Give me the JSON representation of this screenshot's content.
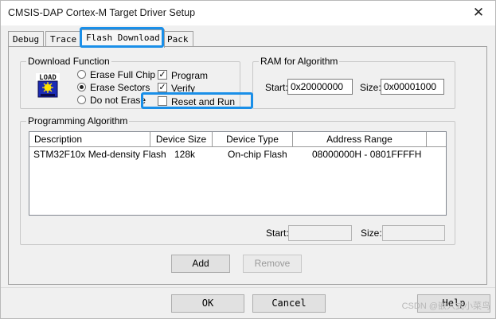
{
  "window": {
    "title": "CMSIS-DAP Cortex-M Target Driver Setup",
    "close_glyph": "✕"
  },
  "tabs": [
    {
      "label": "Debug",
      "active": false
    },
    {
      "label": "Trace",
      "active": false
    },
    {
      "label": "Flash Download",
      "active": true
    },
    {
      "label": "Pack",
      "active": false
    }
  ],
  "download_function": {
    "title": "Download Function",
    "icon": "load-icon",
    "icon_text": "LOAD",
    "erase_options": [
      {
        "label": "Erase Full Chip",
        "selected": false
      },
      {
        "label": "Erase Sectors",
        "selected": true
      },
      {
        "label": "Do not Erase",
        "selected": false
      }
    ],
    "checks": [
      {
        "label": "Program",
        "checked": true
      },
      {
        "label": "Verify",
        "checked": true
      },
      {
        "label": "Reset and Run",
        "checked": false
      }
    ]
  },
  "ram": {
    "title": "RAM for Algorithm",
    "start_label": "Start:",
    "start_value": "0x20000000",
    "size_label": "Size:",
    "size_value": "0x00001000"
  },
  "programming": {
    "title": "Programming Algorithm",
    "columns": [
      "Description",
      "Device Size",
      "Device Type",
      "Address Range"
    ],
    "rows": [
      [
        "STM32F10x Med-density Flash",
        "128k",
        "On-chip Flash",
        "08000000H - 0801FFFFH"
      ]
    ],
    "start_label": "Start:",
    "size_label": "Size:",
    "add_label": "Add",
    "remove_label": "Remove"
  },
  "footer": {
    "ok_label": "OK",
    "cancel_label": "Cancel",
    "help_label": "Help",
    "watermark": "CSDN @嵌入式小菜鸟"
  },
  "colors": {
    "highlight": "#1a8fe8"
  }
}
